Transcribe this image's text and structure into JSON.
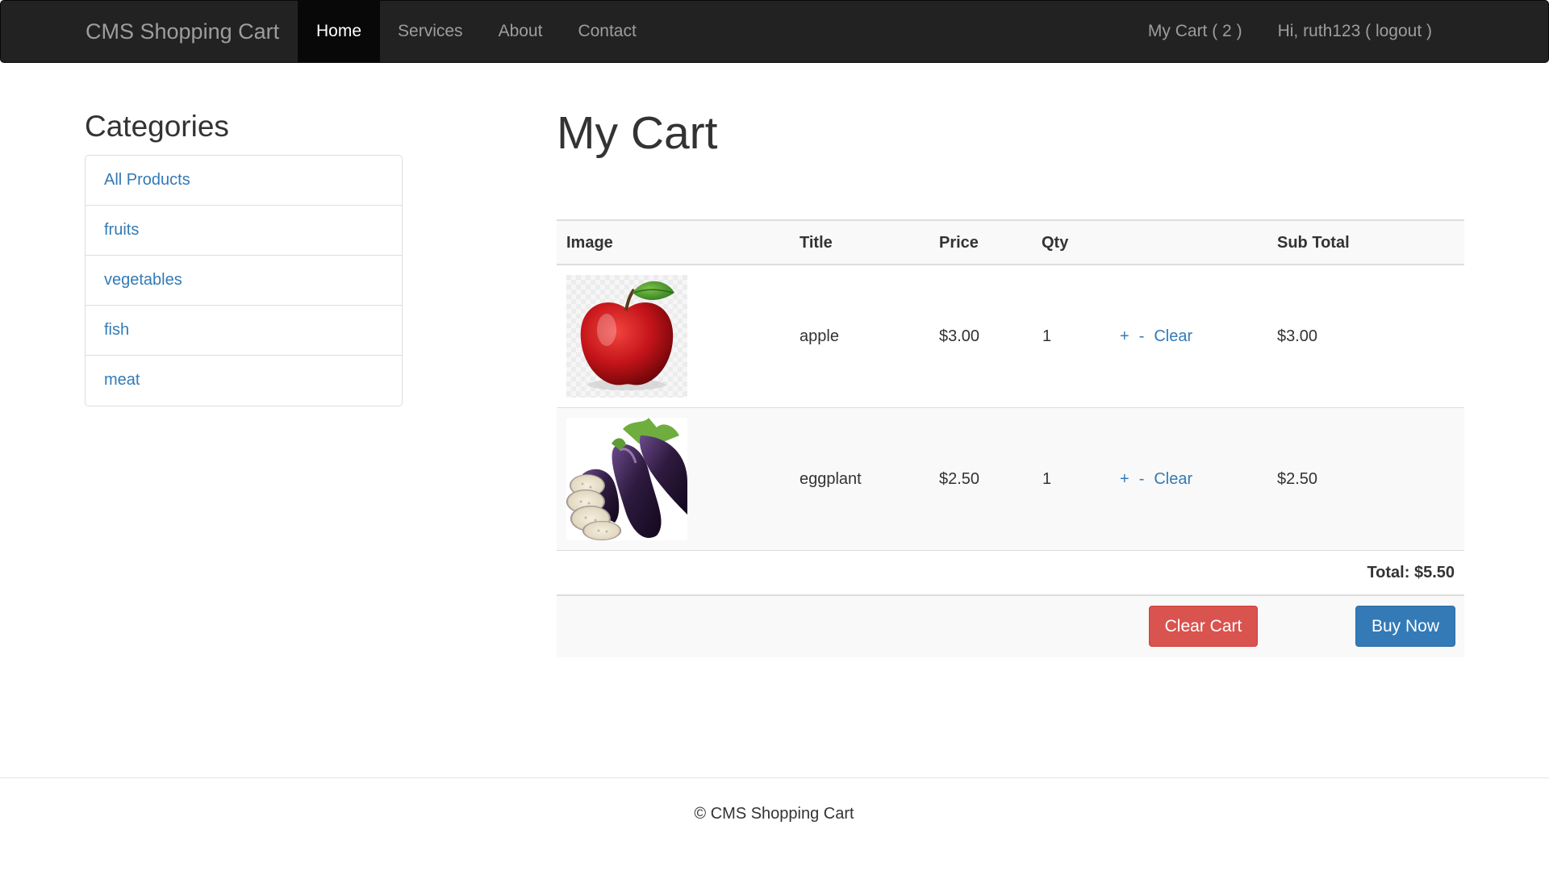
{
  "navbar": {
    "brand": "CMS Shopping Cart",
    "links": [
      "Home",
      "Services",
      "About",
      "Contact"
    ],
    "active": "Home",
    "cart_link": "My Cart ( 2 )",
    "user_link": "Hi, ruth123 ( logout )"
  },
  "sidebar": {
    "heading": "Categories",
    "items": [
      "All Products",
      "fruits",
      "vegetables",
      "fish",
      "meat"
    ]
  },
  "main": {
    "title": "My Cart",
    "columns": [
      "Image",
      "Title",
      "Price",
      "Qty",
      "",
      "Sub Total"
    ],
    "rows": [
      {
        "title": "apple",
        "price": "$3.00",
        "qty": "1",
        "plus": "+",
        "minus": "-",
        "clear": "Clear",
        "subtotal": "$3.00",
        "image": "apple-image"
      },
      {
        "title": "eggplant",
        "price": "$2.50",
        "qty": "1",
        "plus": "+",
        "minus": "-",
        "clear": "Clear",
        "subtotal": "$2.50",
        "image": "eggplant-image"
      }
    ],
    "total": "Total: $5.50",
    "clear_cart_label": "Clear Cart",
    "buy_now_label": "Buy Now"
  },
  "footer": {
    "text": "© CMS Shopping Cart"
  },
  "colors": {
    "navbar_bg": "#222222",
    "link": "#337ab7",
    "danger": "#d9534f",
    "primary": "#337ab7"
  }
}
